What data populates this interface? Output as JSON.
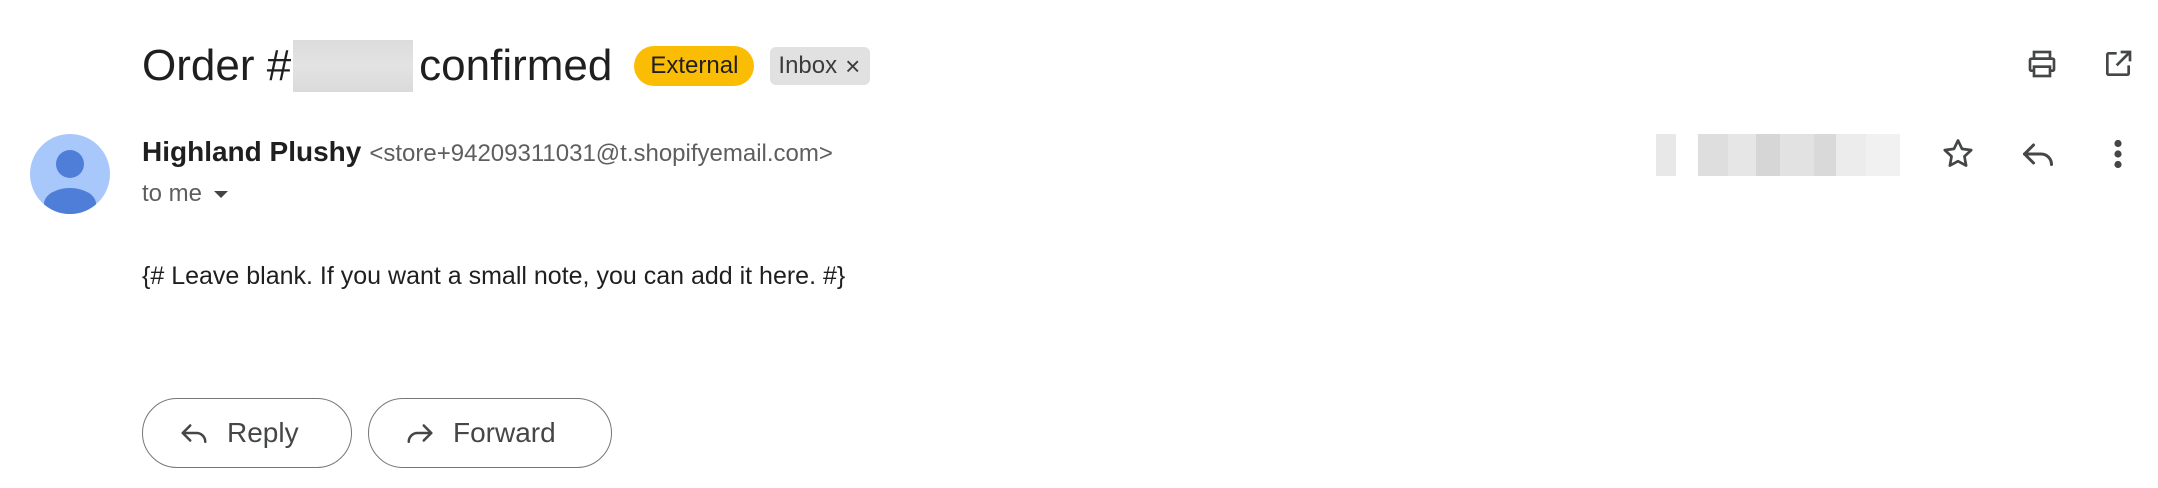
{
  "email": {
    "subject_prefix": "Order #",
    "subject_suffix": "confirmed",
    "labels": {
      "external": "External",
      "inbox": "Inbox",
      "inbox_remove": "×"
    },
    "sender": {
      "name": "Highland Plushy",
      "email": "<store+94209311031@t.shopifyemail.com>"
    },
    "recipient_label": "to me",
    "body": "{# Leave blank. If you want a small note, you can add it here. #}"
  },
  "actions": {
    "reply": "Reply",
    "forward": "Forward"
  },
  "colors": {
    "external_badge": "#fbbc04",
    "inbox_badge": "#e1e1e1",
    "avatar_bg": "#a8c7fa",
    "avatar_fg": "#4f7ed9"
  },
  "icons": {
    "top": [
      "print-icon",
      "open-in-new-window-icon"
    ],
    "header_actions": [
      "star-icon",
      "reply-icon",
      "more-vertical-icon"
    ]
  }
}
